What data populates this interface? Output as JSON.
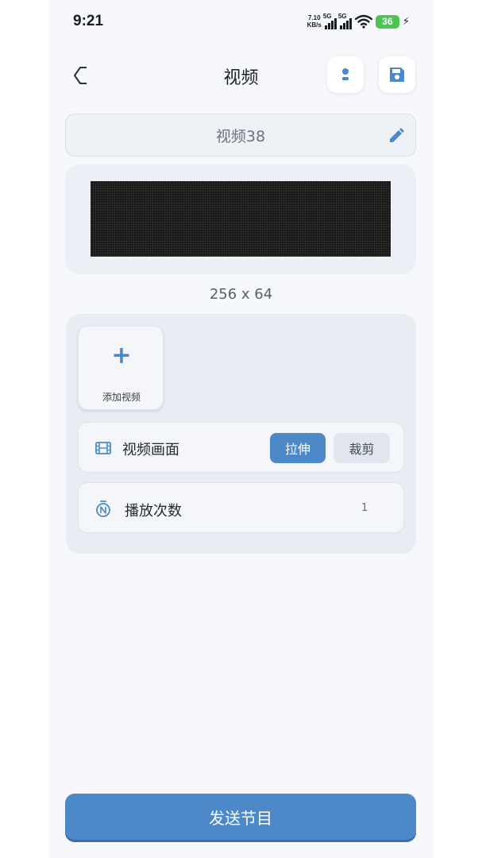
{
  "status_bar": {
    "time": "9:21",
    "net_speed_value": "7.10",
    "net_speed_unit": "KB/s",
    "sim1_label": "5G",
    "sim2_label": "5G",
    "battery_level": "36",
    "battery_color": "#4cc553"
  },
  "header": {
    "title": "视频",
    "back_icon": "back-arrow-icon",
    "preview_icon": "device-preview-icon",
    "save_icon": "floppy-save-icon"
  },
  "program": {
    "name": "视频38",
    "edit_icon": "pencil-icon"
  },
  "preview": {
    "resolution": "256 x 64"
  },
  "settings": {
    "add_video_label": "添加视频",
    "add_icon": "plus-icon",
    "frame": {
      "label": "视频画面",
      "icon": "film-icon",
      "options": [
        "拉伸",
        "裁剪"
      ],
      "selected": "拉伸"
    },
    "play_count": {
      "label": "播放次数",
      "icon": "counter-icon",
      "value": "1"
    }
  },
  "footer": {
    "send_label": "发送节目"
  },
  "colors": {
    "accent": "#4d88c9",
    "background": "#f6f8fb"
  }
}
